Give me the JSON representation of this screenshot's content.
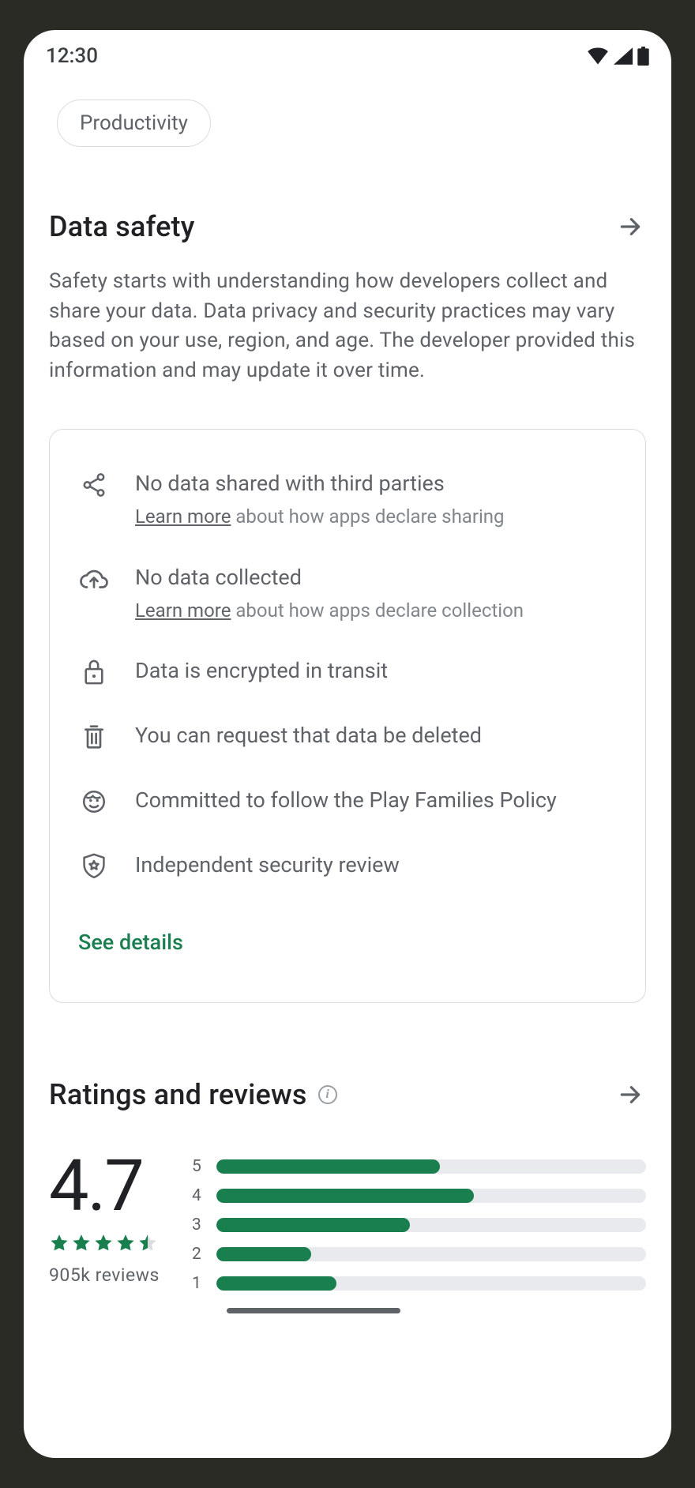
{
  "statusbar": {
    "time": "12:30"
  },
  "chip": {
    "label": "Productivity"
  },
  "data_safety": {
    "title": "Data safety",
    "description": "Safety starts with understanding how developers collect and share your data. Data privacy and security practices may vary based on your use, region, and age. The developer provided this information and may update it over time.",
    "items": [
      {
        "primary": "No data shared with third parties",
        "learn_more": "Learn more",
        "sub_rest": " about how apps declare sharing"
      },
      {
        "primary": "No data collected",
        "learn_more": "Learn more",
        "sub_rest": " about how apps declare collection"
      },
      {
        "primary": "Data is encrypted in transit"
      },
      {
        "primary": "You can request that data be deleted"
      },
      {
        "primary": "Committed to follow the Play Families Policy"
      },
      {
        "primary": "Independent security review"
      }
    ],
    "see_details": "See details"
  },
  "ratings": {
    "title": "Ratings and reviews",
    "score": "4.7",
    "review_count": "905k  reviews",
    "bars": [
      {
        "label": "5",
        "pct": 52
      },
      {
        "label": "4",
        "pct": 60
      },
      {
        "label": "3",
        "pct": 45
      },
      {
        "label": "2",
        "pct": 22
      },
      {
        "label": "1",
        "pct": 28
      }
    ]
  },
  "colors": {
    "accent": "#1a7f4e"
  }
}
